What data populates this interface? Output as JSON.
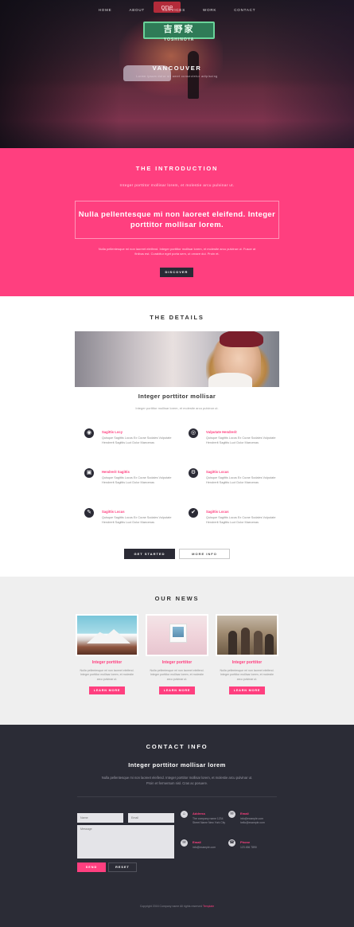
{
  "theme": {
    "accent": "#ff3f7f",
    "dark": "#2a2a35",
    "footer_bg": "#2b2c36",
    "news_bg": "#efefef"
  },
  "hero": {
    "nav": [
      "HOME",
      "ABOUT",
      "SERVICES",
      "WORK",
      "CONTACT"
    ],
    "sign_main": "吉野家",
    "sign_sub": "YOSHINOYA",
    "red_sign": "one",
    "title": "VANCOUVER",
    "subtitle": "Lorem ipsum dolor sit amet consectetur adipiscing"
  },
  "intro": {
    "heading": "THE INTRODUCTION",
    "lead": "Integer porttitor mollisar lorem, et molestie arcu pulvinar ut.",
    "quote": "Nulla pellentesque mi non laoreet eleifend. Integer porttitor mollisar lorem.",
    "body": "Nulla pellentesque mi non laoreet eleifend. Integer porttitor mollisar lorem, et molestie arcu pulvinar ut. Fusce at finibus est. Curabitur eget porta sem, ut ornare dui. Proin et.",
    "button": "DISCOVER"
  },
  "details": {
    "heading": "THE DETAILS",
    "subheading": "Integer porttitor mollisar",
    "sub_text": "Integer porttitor mollisar lorem, et molestie arcu pulvinar ut.",
    "features": [
      {
        "icon": "◉",
        "title": "Sagittis Locy",
        "desc": "Quisque Sagittis Locus Ex Curae Sodales Vulputate Hendrerit Sagittis Luct Dolor Maecenas"
      },
      {
        "icon": "◎",
        "title": "Vulputate Hendrerit",
        "desc": "Quisque Sagittis Locus Ex Curae Sodales Vulputate Hendrerit Sagittis Luct Dolor Maecenas"
      },
      {
        "icon": "▣",
        "title": "Hendrerit Sagittis",
        "desc": "Quisque Sagittis Locus Ex Curae Sodales Vulputate Hendrerit Sagittis Luct Dolor Maecenas"
      },
      {
        "icon": "⚙",
        "title": "Sagittis Locus",
        "desc": "Quisque Sagittis Locus Ex Curae Sodales Vulputate Hendrerit Sagittis Luct Dolor Maecenas"
      },
      {
        "icon": "✎",
        "title": "Sagittis Locus",
        "desc": "Quisque Sagittis Locus Ex Curae Sodales Vulputate Hendrerit Sagittis Luct Dolor Maecenas"
      },
      {
        "icon": "✔",
        "title": "Sagittis Locus",
        "desc": "Quisque Sagittis Locus Ex Curae Sodales Vulputate Hendrerit Sagittis Luct Dolor Maecenas"
      }
    ],
    "btn_primary": "GET STARTED",
    "btn_secondary": "MORE INFO"
  },
  "news": {
    "heading": "OUR NEWS",
    "cards": [
      {
        "title": "Integer porttitor",
        "desc": "Nulla pellentesque mi non laoreet eleifend. Integer porttitor mollisar lorem, et molestie arcu pulvinar ut.",
        "button": "LEARN MORE"
      },
      {
        "title": "Integer porttitor",
        "desc": "Nulla pellentesque mi non laoreet eleifend. Integer porttitor mollisar lorem, et molestie arcu pulvinar ut.",
        "button": "LEARN MORE"
      },
      {
        "title": "Integer porttitor",
        "desc": "Nulla pellentesque mi non laoreet eleifend. Integer porttitor mollisar lorem, et molestie arcu pulvinar ut.",
        "button": "LEARN MORE"
      }
    ]
  },
  "contact": {
    "heading": "CONTACT INFO",
    "subheading": "Integer porttitor mollisar lorem",
    "lead": "Nulla pellentesque mi non laoreet eleifend. Integer porttitor mollisar lorem, et molestie arcu pulvinar ut. Proin et fermentum nisl. Cras ac posuere.",
    "name_placeholder": "Name",
    "email_placeholder": "Email",
    "message_placeholder": "Message",
    "send": "SEND",
    "reset": "RESET",
    "info": [
      {
        "icon": "⌂",
        "title": "Address",
        "desc": "The company name 1234 Street Name New York City"
      },
      {
        "icon": "✉",
        "title": "Email",
        "desc": "info@example.com hello@example.com"
      },
      {
        "icon": "✉",
        "title": "Email",
        "desc": "info@example.com"
      },
      {
        "icon": "☎",
        "title": "Phone",
        "desc": "123 456 7890"
      }
    ],
    "footer_text": "Copyright 2016 Company name All rights reserved ",
    "footer_link": "Template"
  }
}
